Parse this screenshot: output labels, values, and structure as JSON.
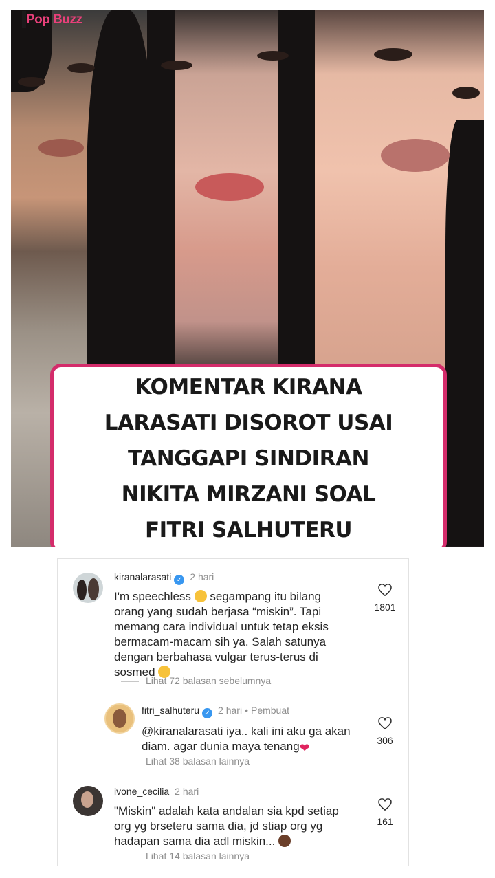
{
  "brand": {
    "name": "Pop Buzz"
  },
  "headline": {
    "lines": [
      "KOMENTAR KIRANA",
      "LARASATI DISOROT USAI",
      "TANGGAPI SINDIRAN",
      "NIKITA MIRZANI SOAL",
      "FITRI SALHUTERU"
    ]
  },
  "comments": [
    {
      "username": "kiranalarasati",
      "verified": true,
      "time": "2 hari",
      "lines": [
        "I'm speechless",
        "segampang itu bilang",
        "orang yang sudah berjasa “miskin”. Tapi",
        "memang cara individual untuk tetap eksis",
        "bermacam-macam sih ya. Salah satunya",
        "dengan berbahasa vulgar terus-terus di",
        "sosmed"
      ],
      "likes": "1801",
      "replies": "Lihat 72 balasan sebelumnya"
    },
    {
      "username": "fitri_salhuteru",
      "verified": true,
      "time": "2 hari",
      "creator": "Pembuat",
      "lines": [
        "@kiranalarasati iya.. kali ini aku ga akan",
        "diam. agar dunia maya tenang"
      ],
      "likes": "306",
      "replies": "Lihat 38 balasan lainnya"
    },
    {
      "username": "ivone_cecilia",
      "verified": false,
      "time": "2 hari",
      "lines": [
        "\"Miskin\" adalah kata andalan sia kpd setiap",
        "org yg brseteru sama dia, jd stiap org yg",
        "hadapan sama dia adl miskin..."
      ],
      "likes": "161",
      "replies": "Lihat 14 balasan lainnya"
    }
  ],
  "colors": {
    "headline_border": "#d42c6b",
    "brand": "#e8407a",
    "verified": "#3897f0",
    "muted_text": "#8e8e8e"
  }
}
